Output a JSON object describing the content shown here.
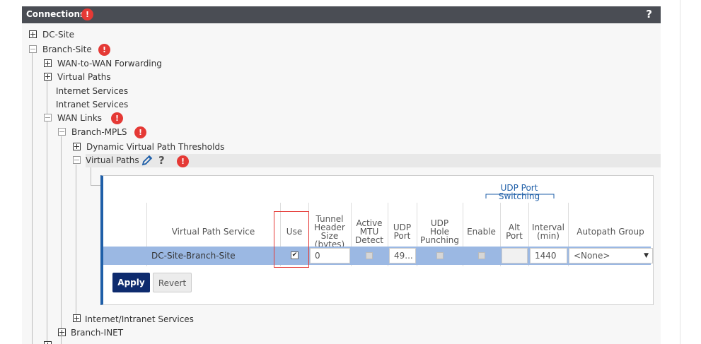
{
  "header": {
    "title": "Connections",
    "help": "?"
  },
  "tree": {
    "dc_site": "DC-Site",
    "branch_site": "Branch-Site",
    "wan_to_wan": "WAN-to-WAN Forwarding",
    "virtual_paths_top": "Virtual Paths",
    "internet_services": "Internet Services",
    "intranet_services": "Intranet Services",
    "wan_links": "WAN Links",
    "branch_mpls": "Branch-MPLS",
    "dvp_thresholds": "Dynamic Virtual Path Thresholds",
    "virtual_paths": "Virtual Paths",
    "virtual_paths_help": "?",
    "internet_intranet": "Internet/Intranet Services",
    "branch_inet": "Branch-INET"
  },
  "alerts": {
    "symbol": "!"
  },
  "table": {
    "group_header": "UDP Port Switching",
    "columns": {
      "vps": "Virtual Path Service",
      "use": "Use",
      "tunnel": [
        "Tunnel",
        "Header",
        "Size",
        "(bytes)"
      ],
      "mtu": [
        "Active",
        "MTU",
        "Detect"
      ],
      "udp_port": [
        "UDP",
        "Port"
      ],
      "hole": [
        "UDP",
        "Hole",
        "Punching"
      ],
      "enable": "Enable",
      "alt_port": [
        "Alt",
        "Port"
      ],
      "interval": [
        "Interval",
        "(min)"
      ],
      "autopath": "Autopath Group"
    },
    "row": {
      "service": "DC-Site-Branch-Site",
      "use_checked": true,
      "tunnel_header": "0",
      "udp_port": "49...",
      "interval": "1440",
      "autopath": "<None>",
      "dropdown": "▼",
      "check": "✔"
    }
  },
  "buttons": {
    "apply": "Apply",
    "revert": "Revert"
  },
  "colors": {
    "accent": "#1f5fa8",
    "apply": "#0e2b6e",
    "alert": "#e53935",
    "row_highlight": "#9bb8e3"
  }
}
